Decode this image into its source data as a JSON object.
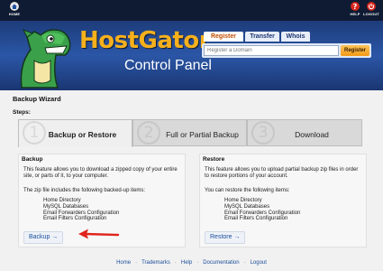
{
  "topbar": {
    "home_label": "HOME",
    "help_label": "HELP",
    "logout_label": "LOGOUT",
    "colors": {
      "background": "#0f1b33",
      "help_icon": "#d9261c",
      "logout_icon": "#d9261c"
    }
  },
  "header": {
    "brand_name": "HostGator",
    "brand_subtitle": "Control Panel",
    "tabs": [
      {
        "label": "Register",
        "active": true
      },
      {
        "label": "Transfer",
        "active": false
      },
      {
        "label": "Whois",
        "active": false
      }
    ],
    "domain_placeholder": "Register a Domain",
    "domain_button": "Register",
    "colors": {
      "brand": "#f6b01c",
      "header_blue": "#2b56a6",
      "button_orange": "#f29a17"
    }
  },
  "page": {
    "title": "Backup Wizard",
    "steps_label": "Steps:",
    "steps": [
      {
        "number": "1",
        "label": "Backup or Restore",
        "active": true
      },
      {
        "number": "2",
        "label": "Full or Partial Backup",
        "active": false
      },
      {
        "number": "3",
        "label": "Download",
        "active": false
      }
    ]
  },
  "backup": {
    "title": "Backup",
    "description": "This feature allows you to download a zipped copy of your entire site, or parts of it, to your computer.",
    "includes_label": "The zip file includes the following backed-up items:",
    "items": [
      "Home Directory",
      "MySQL Databases",
      "Email Forwarders Configuration",
      "Email Filters Configuration"
    ],
    "button_label": "Backup →"
  },
  "restore": {
    "title": "Restore",
    "description": "This feature allows you to upload partial backup zip files in order to restore portions of your account.",
    "includes_label": "You can restore the following items:",
    "items": [
      "Home Directory",
      "MySQL Databases",
      "Email Forwarders Configuration",
      "Email Filters Configuration"
    ],
    "button_label": "Restore →"
  },
  "annotation": {
    "color": "#e0241b",
    "icon": "red-arrow-icon"
  },
  "footer": {
    "links": [
      "Home",
      "Trademarks",
      "Help",
      "Documentation",
      "Logout"
    ]
  }
}
